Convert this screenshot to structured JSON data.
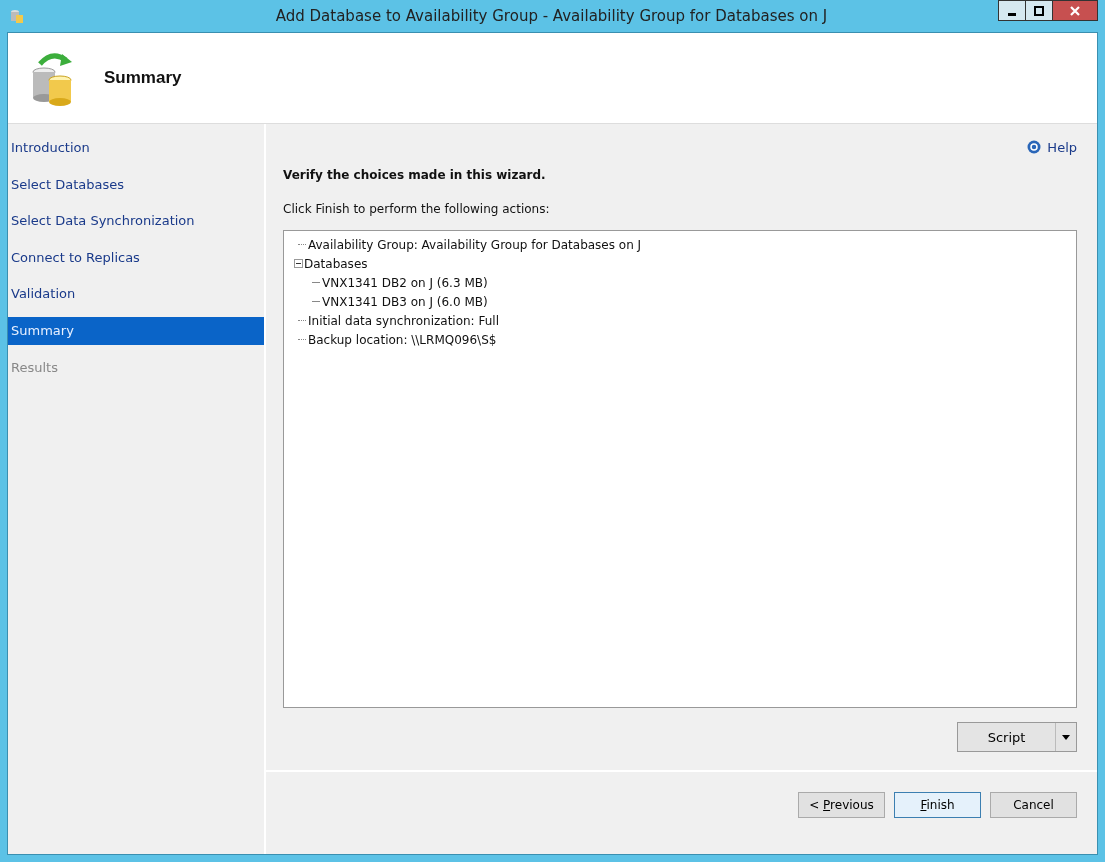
{
  "window": {
    "title": "Add Database to Availability Group - Availability Group for Databases on J"
  },
  "header": {
    "title": "Summary"
  },
  "sidebar": {
    "items": [
      {
        "label": "Introduction",
        "selected": false,
        "disabled": false
      },
      {
        "label": "Select Databases",
        "selected": false,
        "disabled": false
      },
      {
        "label": "Select Data Synchronization",
        "selected": false,
        "disabled": false
      },
      {
        "label": "Connect to Replicas",
        "selected": false,
        "disabled": false
      },
      {
        "label": "Validation",
        "selected": false,
        "disabled": false
      },
      {
        "label": "Summary",
        "selected": true,
        "disabled": false
      },
      {
        "label": "Results",
        "selected": false,
        "disabled": true
      }
    ]
  },
  "help": {
    "label": "Help"
  },
  "heading": "Verify the choices made in this wizard.",
  "instruction": "Click Finish to perform the following actions:",
  "tree": [
    {
      "label": "Availability Group: Availability Group for Databases on J"
    },
    {
      "label": "Databases",
      "expanded": true,
      "children": [
        {
          "label": "VNX1341 DB2 on J (6.3 MB)"
        },
        {
          "label": "VNX1341 DB3 on J (6.0 MB)"
        }
      ]
    },
    {
      "label": "Initial data synchronization: Full"
    },
    {
      "label": "Backup location: \\\\LRMQ096\\S$"
    }
  ],
  "script_button": {
    "label": "Script"
  },
  "buttons": [
    {
      "before": "< ",
      "mnemonic": "P",
      "after": "revious"
    },
    {
      "mnemonic": "F",
      "after": "inish"
    },
    {
      "after": "Cancel"
    }
  ]
}
